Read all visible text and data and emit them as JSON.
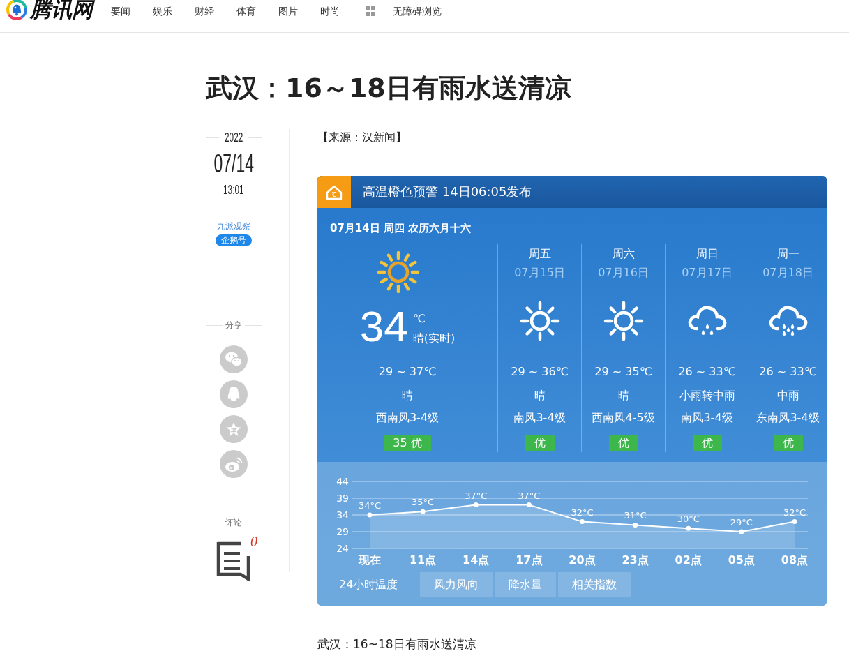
{
  "top_nav": {
    "logo_text": "腾讯网",
    "links": [
      {
        "label": "要闻"
      },
      {
        "label": "娱乐"
      },
      {
        "label": "财经"
      },
      {
        "label": "体育"
      },
      {
        "label": "图片"
      },
      {
        "label": "时尚"
      }
    ],
    "accessibility_link": "无障碍浏览"
  },
  "article": {
    "title": "武汉：16～18日有雨水送清凉",
    "meta": {
      "year": "2022",
      "date": "07/14",
      "time": "13:01",
      "author": "九派观察",
      "author_badge": "企鹅号",
      "share_label": "分享",
      "share_buttons": [
        {
          "kind": "chat"
        },
        {
          "kind": "penguin"
        },
        {
          "kind": "star"
        },
        {
          "kind": "eye"
        }
      ],
      "comment_label": "评论",
      "comment_count": "0"
    },
    "source": "【来源：汉新闻】",
    "weather": {
      "alert": "高温橙色预警 14日06:05发布",
      "date_line": "07月14日 周四 农历六月十六",
      "today": {
        "kind": "sunny",
        "temperature": "34",
        "unit": "℃",
        "condition_now": "晴(实时)",
        "range": "29 ~ 37℃",
        "condition": "晴",
        "wind": "西南风3-4级",
        "aqi": "35 优"
      },
      "forecast": [
        {
          "day": "周五",
          "date": "07月15日",
          "kind": "sunny",
          "range": "29 ~ 36℃",
          "condition": "晴",
          "wind": "南风3-4级",
          "aqi": "优"
        },
        {
          "day": "周六",
          "date": "07月16日",
          "kind": "sunny",
          "range": "29 ~ 35℃",
          "condition": "晴",
          "wind": "西南风4-5级",
          "aqi": "优"
        },
        {
          "day": "周日",
          "date": "07月17日",
          "kind": "light-rain",
          "range": "26 ~ 33℃",
          "condition": "小雨转中雨",
          "wind": "南风3-4级",
          "aqi": "优"
        },
        {
          "day": "周一",
          "date": "07月18日",
          "kind": "moderate-rain",
          "range": "26 ~ 33℃",
          "condition": "中雨",
          "wind": "东南风3-4级",
          "aqi": "优"
        }
      ],
      "chart_data": {
        "type": "area",
        "categories": [
          "现在",
          "11点",
          "14点",
          "17点",
          "20点",
          "23点",
          "02点",
          "05点",
          "08点"
        ],
        "series": [
          {
            "color": "#ffffff",
            "values": [
              34,
              35,
              37,
              37,
              32,
              31,
              30,
              29,
              32
            ]
          }
        ],
        "ylim": [
          24,
          44
        ],
        "yticks": [
          24,
          29,
          34,
          39,
          44
        ],
        "grid": true,
        "value_labels": [
          "34°C",
          "35°C",
          "37°C",
          "37°C",
          "32°C",
          "31°C",
          "30°C",
          "29°C",
          "32°C"
        ]
      },
      "tabs": [
        {
          "label": "24小时温度",
          "selected": true
        },
        {
          "label": "风力风向",
          "selected": false
        },
        {
          "label": "降水量",
          "selected": false
        },
        {
          "label": "相关指数",
          "selected": false
        }
      ]
    },
    "caption": "武汉：16~18日有雨水送清凉"
  }
}
